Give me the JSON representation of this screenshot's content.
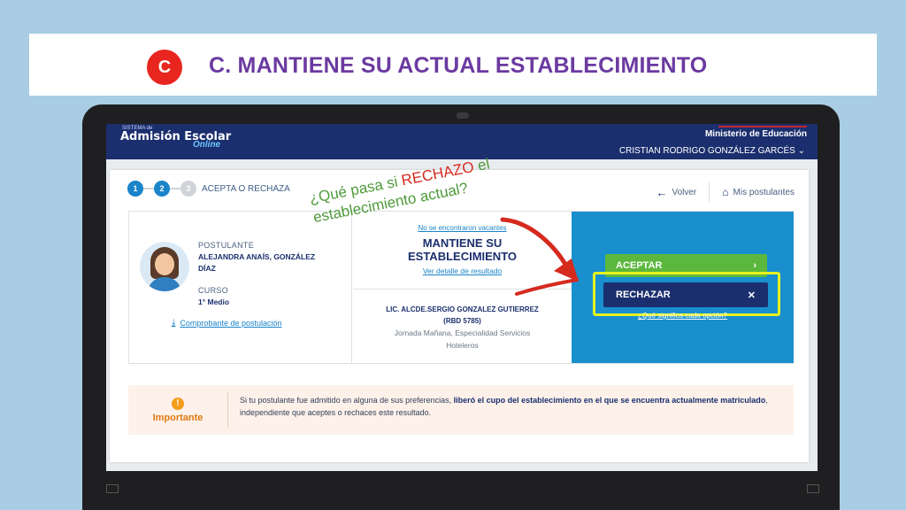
{
  "slide": {
    "badge": "C",
    "title": "C. MANTIENE SU ACTUAL ESTABLECIMIENTO"
  },
  "header": {
    "brand_small": "SISTEMA de",
    "brand": "Admisión Escolar",
    "brand_online": "Online",
    "ministry": "Ministerio de Educación",
    "user": "CRISTIAN RODRIGO GONZÁLEZ GARCÉS"
  },
  "steps": {
    "items": [
      "1",
      "2",
      "3"
    ],
    "label": "ACEPTA O RECHAZA"
  },
  "nav": {
    "back": "Volver",
    "home": "Mis postulantes"
  },
  "applicant": {
    "label": "POSTULANTE",
    "name_line1": "ALEJANDRA ANAÍS, GONZÁLEZ",
    "name_line2": "DÍAZ",
    "course_label": "CURSO",
    "course": "1° Medio",
    "proof_link": "Comprobante de postulación"
  },
  "result": {
    "not_found": "No se encontraron vacantes",
    "status_line1": "MANTIENE SU",
    "status_line2": "ESTABLECIMIENTO",
    "detail_link": "Ver detalle de resultado",
    "school_line1": "LIC. ALCDE.SERGIO GONZALEZ GUTIERREZ",
    "school_line2": "(RBD 5785)",
    "school_sub1": "Jornada Mañana, Especialidad Servicios",
    "school_sub2": "Hoteleros"
  },
  "actions": {
    "accept": "ACEPTAR",
    "reject": "RECHAZAR",
    "help": "¿Qué significa cada opción?"
  },
  "important": {
    "label": "Importante",
    "text_a": "Si tu postulante fue admitido en alguna de sus preferencias, ",
    "text_b": "liberó el cupo del establecimiento en el que se encuentra actualmente matriculado",
    "text_c": ", independiente que aceptes o rechaces este resultado."
  },
  "callout": {
    "part1": "¿Qué pasa si ",
    "highlight": "RECHAZO",
    "part2": " el",
    "line2": "establecimiento actual?"
  },
  "colors": {
    "navy": "#1b2f6e",
    "blue": "#1a8fce",
    "green": "#5cb83d",
    "highlight": "#e6f21f",
    "title": "#6b3aa0",
    "badge": "#e8261f"
  }
}
